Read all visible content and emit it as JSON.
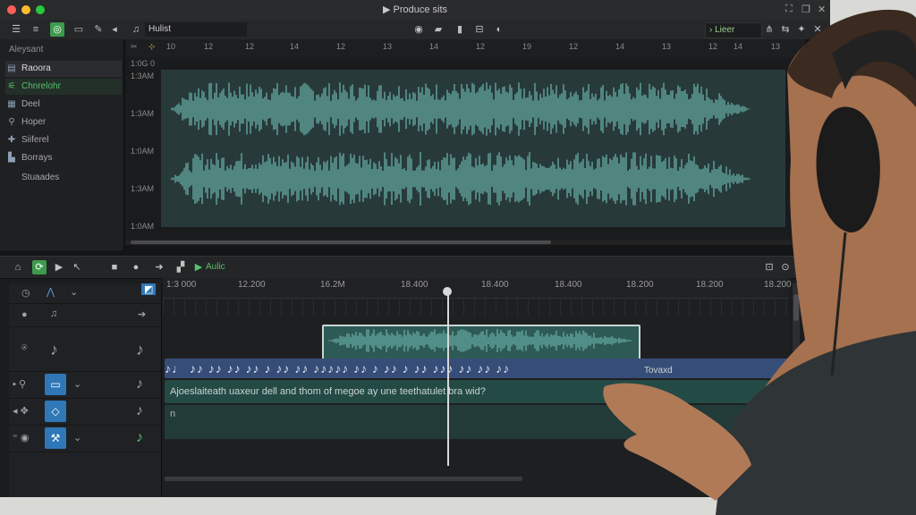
{
  "window": {
    "title": "Produce sits",
    "traffic_lights": [
      "#ff5f57",
      "#febc2e",
      "#28c840"
    ],
    "title_icons": [
      "expand-icon",
      "restore-icon",
      "close-icon"
    ]
  },
  "toolbar": {
    "track_name": "Hulist",
    "preset_label": "Lieer"
  },
  "sidebar": {
    "heading": "Aleysant",
    "items": [
      {
        "icon": "waveform-icon",
        "label": "Raoora",
        "state": "selected"
      },
      {
        "icon": "tune-icon",
        "label": "Chnrelohr",
        "state": "active"
      },
      {
        "icon": "grid-icon",
        "label": "Deel",
        "state": ""
      },
      {
        "icon": "pin-icon",
        "label": "Hoper",
        "state": ""
      },
      {
        "icon": "plus-icon",
        "label": "Siiferel",
        "state": ""
      },
      {
        "icon": "chart-icon",
        "label": "Borrays",
        "state": ""
      },
      {
        "icon": "",
        "label": "Stuaades",
        "state": ""
      }
    ]
  },
  "top_ruler": {
    "ticks": [
      "10",
      "12",
      "12",
      "14",
      "12",
      "13",
      "14",
      "12",
      "19",
      "12",
      "14",
      "13",
      "12",
      "14",
      "13"
    ],
    "start_label": "1:0G 0"
  },
  "wave": {
    "y_labels": [
      "1:3AM",
      "1:3AM",
      "1:0AM",
      "1:3AM",
      "1:0AM"
    ],
    "color": "#5e9f98"
  },
  "sequencer": {
    "audio_label": "Aulic",
    "ruler": [
      "1:3 000",
      "12.200",
      "16.2M",
      "18.400",
      "18.400",
      "18.400",
      "18.200",
      "18.200",
      "18.200"
    ],
    "midi_notes": "♪♩ ♪♪ ♪♪ ♪♪ ♪♪ ♪ ♪♪ ♪♪ ♪♪♪♪♪ ♪♪ ♪ ♪♪ ♪ ♪♪ ♪♪♪ ♪♪ ♪♪ ♪♪",
    "lane_text": "Ajoeslaiteath uaxeur dell and  thom  of megoe ay  une teethatulet bra wid?",
    "lane_tag": "Tovaxd",
    "lane_marker": "n"
  }
}
